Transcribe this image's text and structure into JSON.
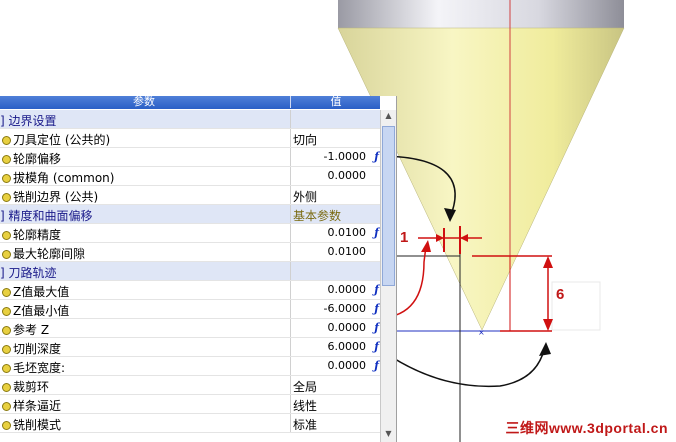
{
  "grid": {
    "header": {
      "param": "参数",
      "value": "值"
    },
    "rows": [
      {
        "type": "cat",
        "name": "] 边界设置",
        "value": ""
      },
      {
        "type": "item",
        "name": "刀具定位 (公共的)",
        "value": "切向",
        "align": "left",
        "fx": ""
      },
      {
        "type": "item",
        "name": "轮廓偏移",
        "value": "-1.0000",
        "align": "right",
        "fx": "ƒ"
      },
      {
        "type": "item",
        "name": "拔模角 (common)",
        "value": "0.0000",
        "align": "right",
        "fx": ""
      },
      {
        "type": "item",
        "name": "铣削边界 (公共)",
        "value": "外侧",
        "align": "left",
        "fx": ""
      },
      {
        "type": "cat",
        "name": "] 精度和曲面偏移",
        "value": "基本参数"
      },
      {
        "type": "item",
        "name": "轮廓精度",
        "value": "0.0100",
        "align": "right",
        "fx": "ƒ"
      },
      {
        "type": "item",
        "name": "最大轮廓间隙",
        "value": "0.0100",
        "align": "right",
        "fx": ""
      },
      {
        "type": "cat",
        "name": "] 刀路轨迹",
        "value": ""
      },
      {
        "type": "item",
        "name": "Z值最大值",
        "value": "0.0000",
        "align": "right",
        "fx": "ƒ"
      },
      {
        "type": "item",
        "name": "Z值最小值",
        "value": "-6.0000",
        "align": "right",
        "fx": "ƒ"
      },
      {
        "type": "item",
        "name": "参考 Z",
        "value": "0.0000",
        "align": "right",
        "fx": "ƒ"
      },
      {
        "type": "item",
        "name": "切削深度",
        "value": "6.0000",
        "align": "right",
        "fx": "ƒ"
      },
      {
        "type": "item",
        "name": "毛坯宽度:",
        "value": "0.0000",
        "align": "right",
        "fx": "ƒ"
      },
      {
        "type": "item",
        "name": "裁剪环",
        "value": "全局",
        "align": "left",
        "fx": ""
      },
      {
        "type": "item",
        "name": "样条逼近",
        "value": "线性",
        "align": "left",
        "fx": ""
      },
      {
        "type": "item",
        "name": "铣削模式",
        "value": "标准",
        "align": "left",
        "fx": ""
      }
    ]
  },
  "annotations": {
    "offset_label": "1",
    "depth_label": "6"
  },
  "watermark": "三维网www.3dportal.cn",
  "colors": {
    "header": "#2a5fc6",
    "category": "#dfe6f6",
    "annotation": "#c01818",
    "cone": "#f2f0a8",
    "cylinder": "#d8d8e0"
  }
}
